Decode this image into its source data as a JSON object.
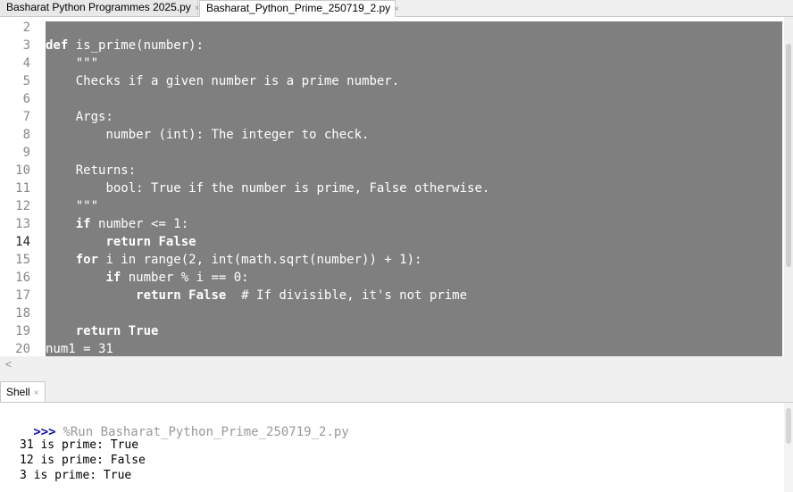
{
  "tabs": [
    {
      "label": "Basharat Python Programmes 2025.py",
      "close": "×"
    },
    {
      "label": "Basharat_Python_Prime_250719_2.py",
      "close": "×"
    }
  ],
  "editor": {
    "line_numbers": [
      "2",
      "3",
      "4",
      "5",
      "6",
      "7",
      "8",
      "9",
      "10",
      "11",
      "12",
      "13",
      "14",
      "15",
      "16",
      "17",
      "18",
      "19",
      "20"
    ],
    "current_line": "14",
    "lines": [
      {
        "indent": "",
        "kw": "",
        "text": ""
      },
      {
        "indent": "",
        "kw": "def ",
        "text": "is_prime(number):"
      },
      {
        "indent": "    ",
        "kw": "",
        "text": "\"\"\""
      },
      {
        "indent": "    ",
        "kw": "",
        "text": "Checks if a given number is a prime number."
      },
      {
        "indent": "",
        "kw": "",
        "text": ""
      },
      {
        "indent": "    ",
        "kw": "",
        "text": "Args:"
      },
      {
        "indent": "        ",
        "kw": "",
        "text": "number (int): The integer to check."
      },
      {
        "indent": "",
        "kw": "",
        "text": ""
      },
      {
        "indent": "    ",
        "kw": "",
        "text": "Returns:"
      },
      {
        "indent": "        ",
        "kw": "",
        "text": "bool: True if the number is prime, False otherwise."
      },
      {
        "indent": "    ",
        "kw": "",
        "text": "\"\"\""
      },
      {
        "indent": "    ",
        "kw": "if ",
        "text": "number <= 1:"
      },
      {
        "indent": "        ",
        "kw": "return False",
        "text": ""
      },
      {
        "indent": "    ",
        "kw": "for ",
        "text": "i in range(2, int(math.sqrt(number)) + 1):"
      },
      {
        "indent": "        ",
        "kw": "if ",
        "text": "number % i == 0:"
      },
      {
        "indent": "            ",
        "kw": "return False",
        "text": "  # If divisible, it's not prime"
      },
      {
        "indent": "",
        "kw": "",
        "text": ""
      },
      {
        "indent": "    ",
        "kw": "return True",
        "text": ""
      },
      {
        "indent": "",
        "kw": "",
        "text": "num1 = 31"
      }
    ]
  },
  "hscroll": {
    "left_arrow": "<"
  },
  "shell": {
    "tab_label": "Shell",
    "tab_close": "×",
    "prompt": ">>>",
    "command": "%Run Basharat_Python_Prime_250719_2.py",
    "output": [
      "31 is prime: True",
      "12 is prime: False",
      "3 is prime: True"
    ]
  }
}
